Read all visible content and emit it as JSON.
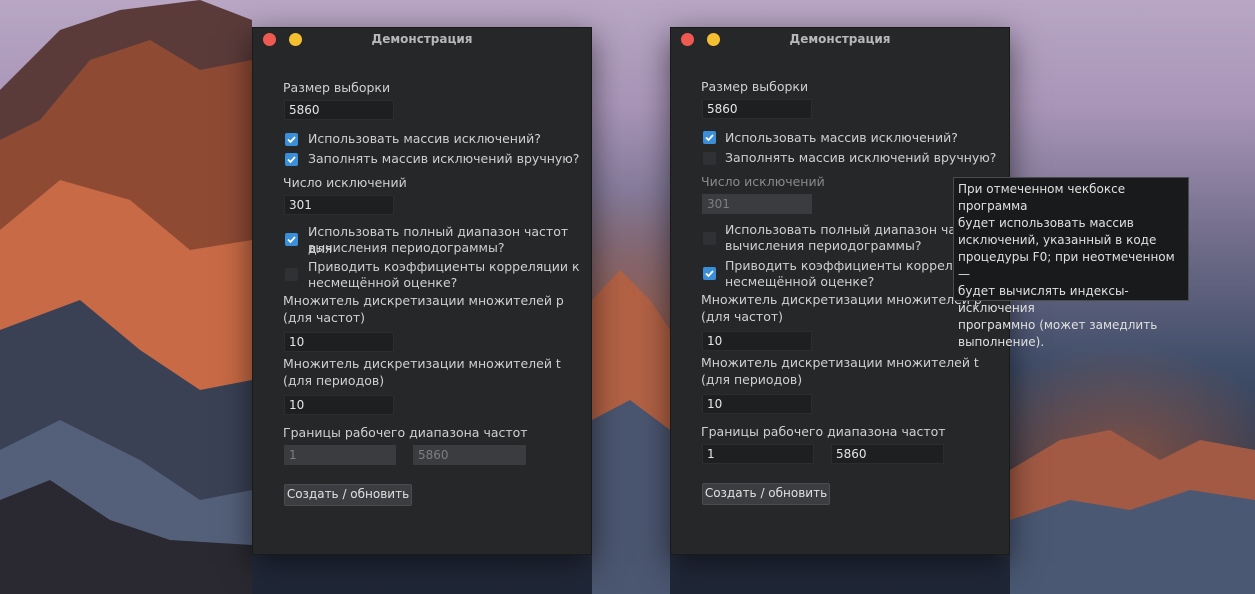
{
  "window_title": "Демонстрация",
  "labels": {
    "sample_size": "Размер выборки",
    "use_exclusions": "Использовать массив исключений?",
    "fill_manually": "Заполнять массив исключений вручную?",
    "exclusion_count": "Число исключений",
    "full_range_1": "Использовать полный диапазон частот для",
    "full_range_2": "вычисления периодограммы?",
    "full_range_cut_1": "Использовать полный диапазон часто",
    "corr_1": "Приводить коэффициенты корреляции к",
    "corr_2": "несмещённой оценке?",
    "corr_cut_1": "Приводить коэффициенты корреляци",
    "mult_p_1": "Множитель дискретизации множителей p",
    "mult_p_cut_1": "Множитель дискретизации множителей р",
    "mult_p_2": "(для частот)",
    "mult_t_1": "Множитель дискретизации множителей t",
    "mult_t_2": "(для периодов)",
    "bounds": "Границы рабочего диапазона частот"
  },
  "button_label": "Создать / обновить",
  "left": {
    "sample_size": "5860",
    "exclusion_count": "301",
    "mult_p": "10",
    "mult_t": "10",
    "bound_low": "1",
    "bound_high": "5860",
    "checks": {
      "use_exclusions": true,
      "fill_manually": true,
      "full_range": true,
      "corr": false
    }
  },
  "right": {
    "sample_size": "5860",
    "exclusion_count": "301",
    "mult_p": "10",
    "mult_t": "10",
    "bound_low": "1",
    "bound_high": "5860",
    "checks": {
      "use_exclusions": true,
      "fill_manually": false,
      "full_range": false,
      "corr": true
    }
  },
  "tooltip_lines": [
    "При отмеченном чекбоксе программа",
    "будет использовать массив",
    "исключений, указанный в коде",
    "процедуры F0; при неотмеченном —",
    "будет вычислять индексы-исключения",
    "программно (может замедлить",
    "выполнение)."
  ],
  "colors": {
    "window_bg": "#262729",
    "accent": "#3b8fd8",
    "close": "#ee5a52",
    "minimize": "#f4bf30"
  }
}
